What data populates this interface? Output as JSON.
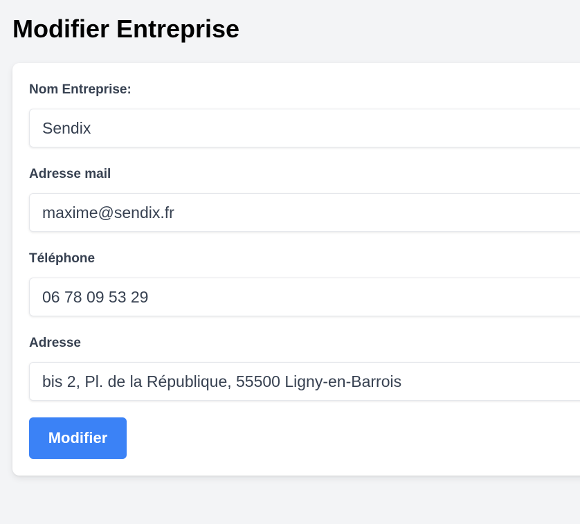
{
  "page": {
    "title": "Modifier Entreprise"
  },
  "form": {
    "company_name": {
      "label": "Nom Entreprise:",
      "value": "Sendix"
    },
    "email": {
      "label": "Adresse mail",
      "value": "maxime@sendix.fr"
    },
    "phone": {
      "label": "Téléphone",
      "value": "06 78 09 53 29"
    },
    "address": {
      "label": "Adresse",
      "value": "bis 2, Pl. de la République, 55500 Ligny-en-Barrois"
    },
    "submit_label": "Modifier"
  },
  "colors": {
    "background": "#f3f4f6",
    "card": "#ffffff",
    "accent": "#3b82f6",
    "label_text": "#374151"
  }
}
